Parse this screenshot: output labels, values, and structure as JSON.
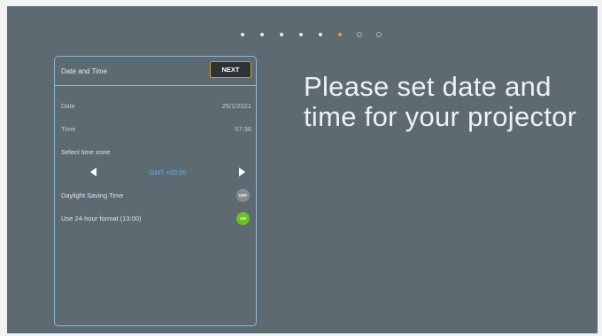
{
  "progress": {
    "steps": [
      "done",
      "done",
      "done",
      "done",
      "done",
      "current",
      "pending",
      "pending"
    ],
    "current_color": "#f0a020"
  },
  "panel": {
    "title": "Date and Time",
    "next_label": "NEXT",
    "date_label": "Date",
    "date_value": "25/1/2021",
    "time_label": "Time",
    "time_value": "07:36",
    "timezone_label": "Select time zone",
    "timezone_value": "GMT +00:00",
    "dst_label": "Daylight Saving Time",
    "dst_state": "OFF",
    "format_label": "Use 24-hour format (13:00)",
    "format_state": "ON"
  },
  "headline": "Please set date and time for your projector",
  "colors": {
    "background": "#5d6a72",
    "accent_border": "#8fb6cf",
    "next_border": "#e09a24",
    "timezone_text": "#5fb4ee",
    "toggle_on": "#6cbf22",
    "toggle_off": "#8b8b8b"
  },
  "icons": {
    "timezone_prev": "triangle-left-icon",
    "timezone_next": "triangle-right-icon"
  }
}
